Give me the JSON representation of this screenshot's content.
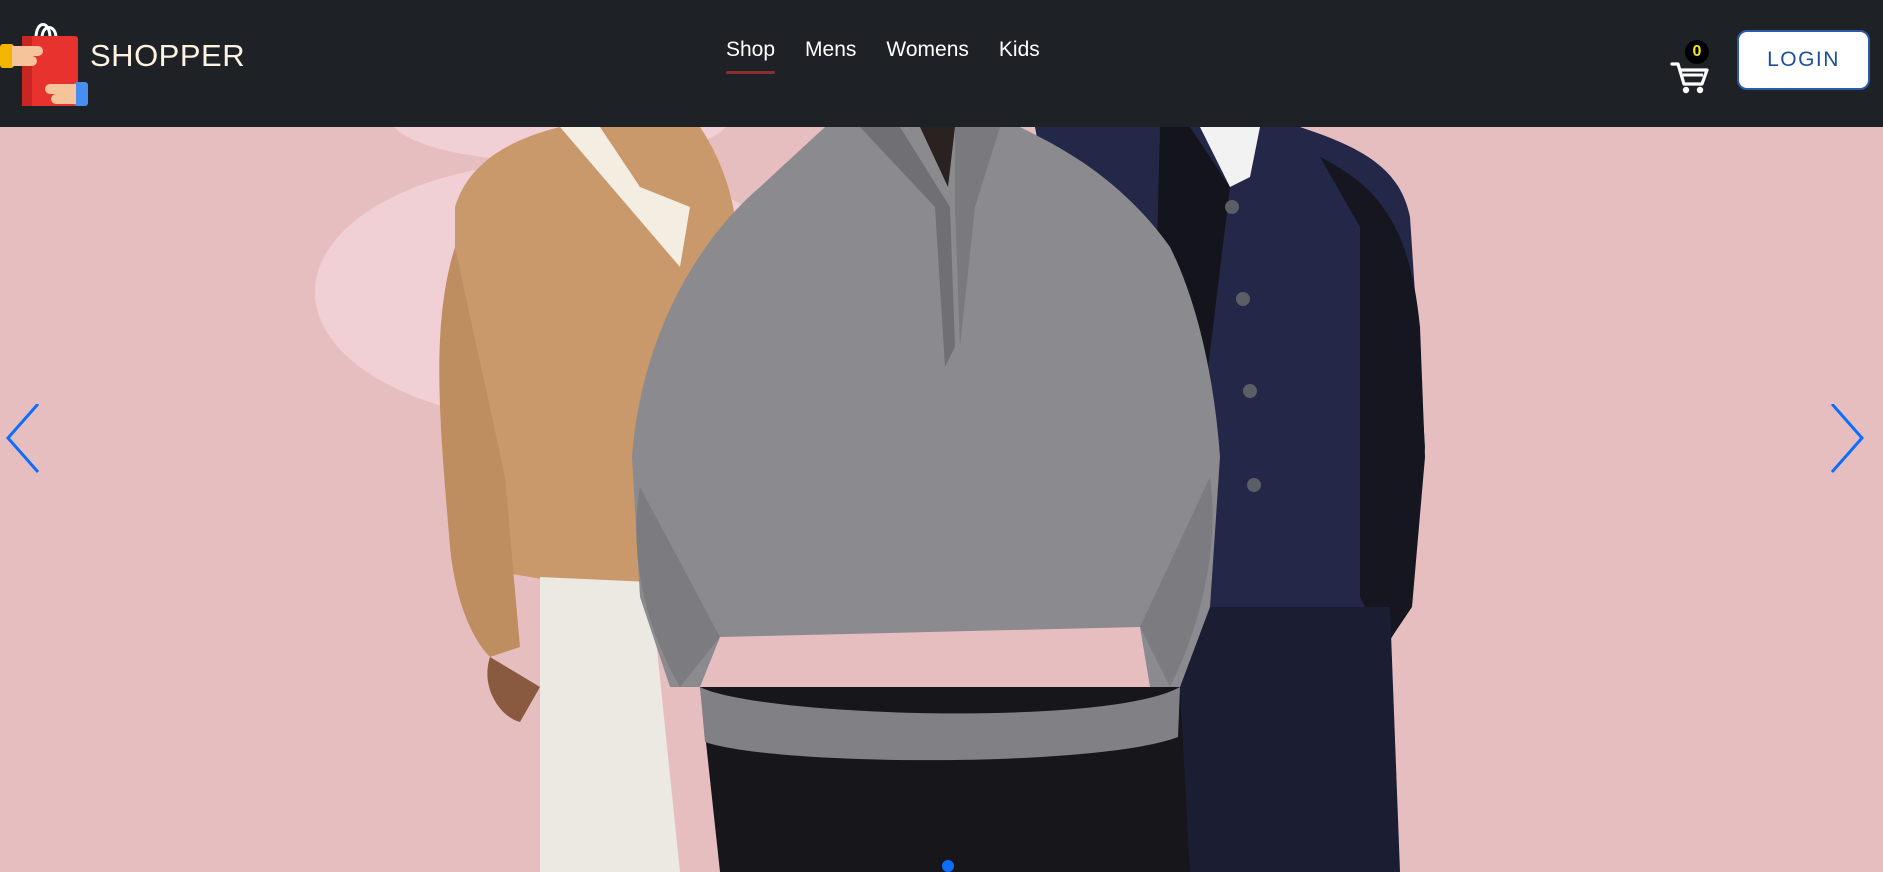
{
  "brand": {
    "name": "SHOPPER",
    "logo_icon": "shopping-bag-hands-icon"
  },
  "nav": {
    "links": [
      "Shop",
      "Mens",
      "Womens",
      "Kids"
    ],
    "active": "Shop"
  },
  "cart": {
    "count": "0",
    "icon": "cart-icon"
  },
  "login": {
    "label": "LOGIN"
  },
  "carousel": {
    "prev_icon": "chevron-left-icon",
    "next_icon": "chevron-right-icon",
    "active_slide": 1,
    "slide_count": 1
  },
  "colors": {
    "navbar_bg": "#1e2227",
    "hero_bg": "#e7bec0",
    "accent_blue": "#0d6efd",
    "active_underline": "#8b2e2e",
    "badge_text": "#f5e51c"
  }
}
